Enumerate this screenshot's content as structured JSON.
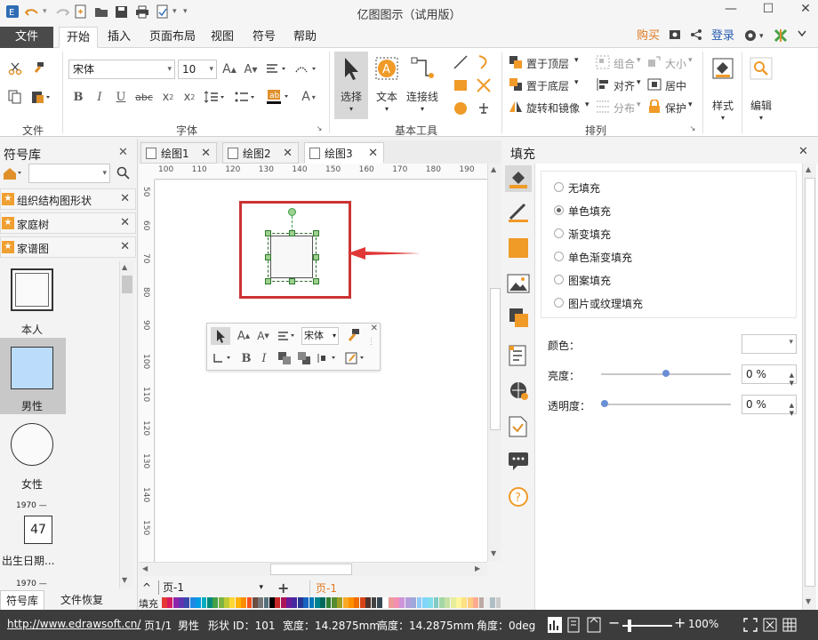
{
  "app": {
    "title": "亿图图示（试用版）"
  },
  "window": {
    "minimize": "—",
    "maximize": "☐",
    "close": "✕"
  },
  "menu": {
    "file": "文件",
    "tabs": [
      "开始",
      "插入",
      "页面布局",
      "视图",
      "符号",
      "帮助"
    ],
    "buy": "购买",
    "login": "登录"
  },
  "ribbon": {
    "font_name": "宋体",
    "font_size": "10",
    "groups": {
      "file": "文件",
      "font": "字体",
      "basic": "基本工具",
      "arrange": "排列"
    },
    "select": "选择",
    "text": "文本",
    "connector": "连接线",
    "bring_front": "置于顶层",
    "send_back": "置于底层",
    "rotate_mirror": "旋转和镜像",
    "group": "组合",
    "size": "大小",
    "align": "对齐",
    "center": "居中",
    "distribute": "分布",
    "protect": "保护",
    "style": "样式",
    "edit": "编辑"
  },
  "left_panel": {
    "title": "符号库",
    "libraries": [
      "组织结构图形状",
      "家庭树",
      "家谱图"
    ],
    "shapes": [
      "本人",
      "男性",
      "女性",
      "出生日期..."
    ],
    "shape_year": "1970 —",
    "shape_number": "47",
    "tabs": [
      "符号库",
      "文件恢复"
    ]
  },
  "doc_tabs": [
    "绘图1",
    "绘图2",
    "绘图3"
  ],
  "rulers": {
    "h": [
      "100",
      "110",
      "120",
      "130",
      "140",
      "150",
      "160",
      "170",
      "180",
      "190"
    ],
    "v": [
      "50",
      "60",
      "70",
      "80",
      "90",
      "100",
      "110",
      "120",
      "130",
      "140",
      "150"
    ]
  },
  "page_bar": {
    "page_select": "页-1",
    "page_tab": "页-1",
    "color_label": "填充"
  },
  "fill_panel": {
    "title": "填充",
    "options": [
      "无填充",
      "单色填充",
      "渐变填充",
      "单色渐变填充",
      "图案填充",
      "图片或纹理填充"
    ],
    "selected": "单色填充",
    "color_label": "颜色：",
    "brightness_label": "亮度：",
    "brightness": "0 %",
    "brightness_level": 0.5,
    "transparency_label": "透明度：",
    "transparency": "0 %",
    "transparency_level": 0.0
  },
  "status": {
    "url": "http://www.edrawsoft.cn/",
    "page": "页1/1",
    "shape_name": "男性",
    "shape_id": "形状 ID：101",
    "width": "宽度：14.2875mm",
    "height": "高度：14.2875mm",
    "angle": "角度：0deg",
    "zoom": "100%"
  },
  "colors": {
    "accent": "#4a4a4a",
    "selection_frame": "#cc3333",
    "handle": "#3aa04a",
    "male_fill": "#bcdcfb",
    "orange": "#f09a28"
  }
}
